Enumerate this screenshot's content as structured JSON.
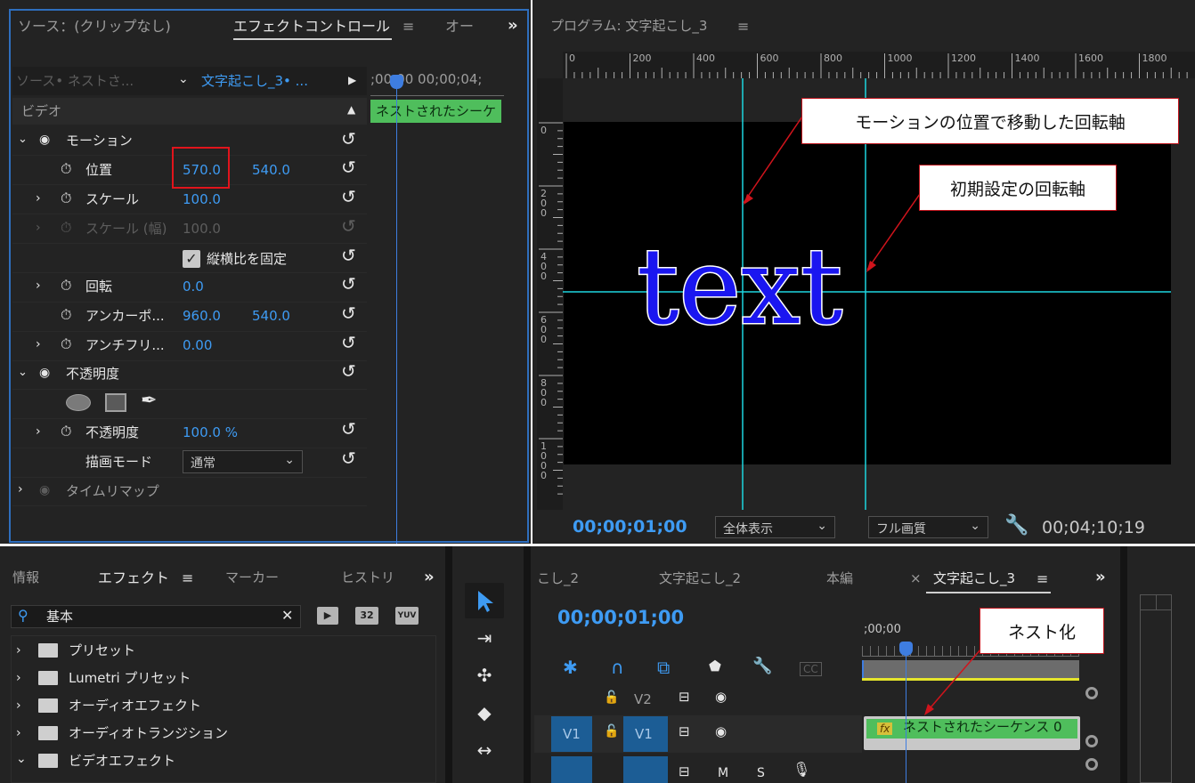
{
  "effect_controls": {
    "tab_source": "ソース：(クリップなし)",
    "tab_effect_controls": "エフェクトコントロール",
    "tab_audio": "オー",
    "source_label": "ソース• ネストさ...",
    "sequence_label": "文字起こし_3• ...",
    "timeline_times": ";00;00 00;00;04;",
    "clip_label": "ネストされたシーケ",
    "video_header": "ビデオ",
    "motion": "モーション",
    "position": {
      "label": "位置",
      "x": "570.0",
      "y": "540.0"
    },
    "scale": {
      "label": "スケール",
      "value": "100.0"
    },
    "scale_width": {
      "label": "スケール (幅)",
      "value": "100.0"
    },
    "uniform_scale": "縦横比を固定",
    "rotation": {
      "label": "回転",
      "value": "0.0"
    },
    "anchor": {
      "label": "アンカーポ...",
      "x": "960.0",
      "y": "540.0"
    },
    "antiflicker": {
      "label": "アンチフリ...",
      "value": "0.00"
    },
    "opacity_group": "不透明度",
    "opacity": {
      "label": "不透明度",
      "value": "100.0 %"
    },
    "blend_mode": {
      "label": "描画モード",
      "value": "通常"
    },
    "time_remap": "タイムリマップ"
  },
  "program_monitor": {
    "title": "プログラム: 文字起こし_3",
    "ruler_top": [
      "0",
      "200",
      "400",
      "600",
      "800",
      "1000",
      "1200",
      "1400",
      "1600",
      "1800"
    ],
    "ruler_left": [
      "0",
      "200",
      "400",
      "600",
      "800",
      "1000"
    ],
    "video_text": "text",
    "timecode": "00;00;01;00",
    "zoom": "全体表示",
    "quality": "フル画質",
    "duration": "00;04;10;19",
    "callout_motion": "モーションの位置で移動した回転軸",
    "callout_default": "初期設定の回転軸"
  },
  "effects_panel": {
    "tab_info": "情報",
    "tab_effects": "エフェクト",
    "tab_markers": "マーカー",
    "tab_history": "ヒストリ",
    "search_value": "基本",
    "badge_32": "32",
    "badge_yuv": "YUV",
    "items": [
      "プリセット",
      "Lumetri プリセット",
      "オーディオエフェクト",
      "オーディオトランジション",
      "ビデオエフェクト"
    ]
  },
  "timeline": {
    "tab_1": "こし_2",
    "tab_2": "文字起こし_2",
    "tab_3": "本編",
    "tab_4": "文字起こし_3",
    "close": "×",
    "timecode": "00;00;01;00",
    "ruler_time": ";00;00",
    "cc": "CC",
    "track_v2": "V2",
    "track_v1": "V1",
    "source_v1": "V1",
    "mute": "M",
    "solo": "S",
    "fx": "fx",
    "clip_label": "ネストされたシーケンス 0",
    "callout_nest": "ネスト化"
  },
  "colors": {
    "accent": "#3e9bf3",
    "clip_green": "#4fbe5c",
    "callout_border": "#c0141c",
    "guide_cyan": "#1dd6e0"
  }
}
